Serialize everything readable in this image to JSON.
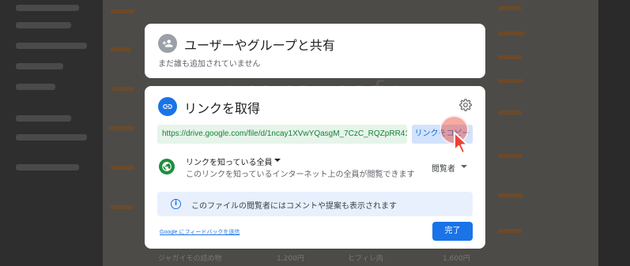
{
  "share_dialog": {
    "title": "ユーザーやグループと共有",
    "subtitle": "まだ誰も追加されていません",
    "icon": "person-add-icon"
  },
  "link_dialog": {
    "title": "リンクを取得",
    "icon": "link-icon",
    "url": "https://drive.google.com/file/d/1ncay1XVwYQasgM_7CzC_RQZpRR41...",
    "copy_label": "リンクをコピー",
    "access": {
      "label": "リンクを知っている全員",
      "description": "このリンクを知っているインターネット上の全員が閲覧できます",
      "role": "閲覧者"
    },
    "info": "このファイルの閲覧者にはコメントや提案も表示されます",
    "feedback_label": "Google にフィードバックを送信",
    "done_label": "完了"
  },
  "background": {
    "watermark": "arara cafe",
    "menu_item": "ジャガイモの詰め物",
    "menu_price": "1,200円",
    "menu_item2": "ヒフィレ肉",
    "menu_price2": "1,600円"
  },
  "colors": {
    "primary": "#1a73e8",
    "url_green": "#188038",
    "click_ring": "#ea4335"
  }
}
